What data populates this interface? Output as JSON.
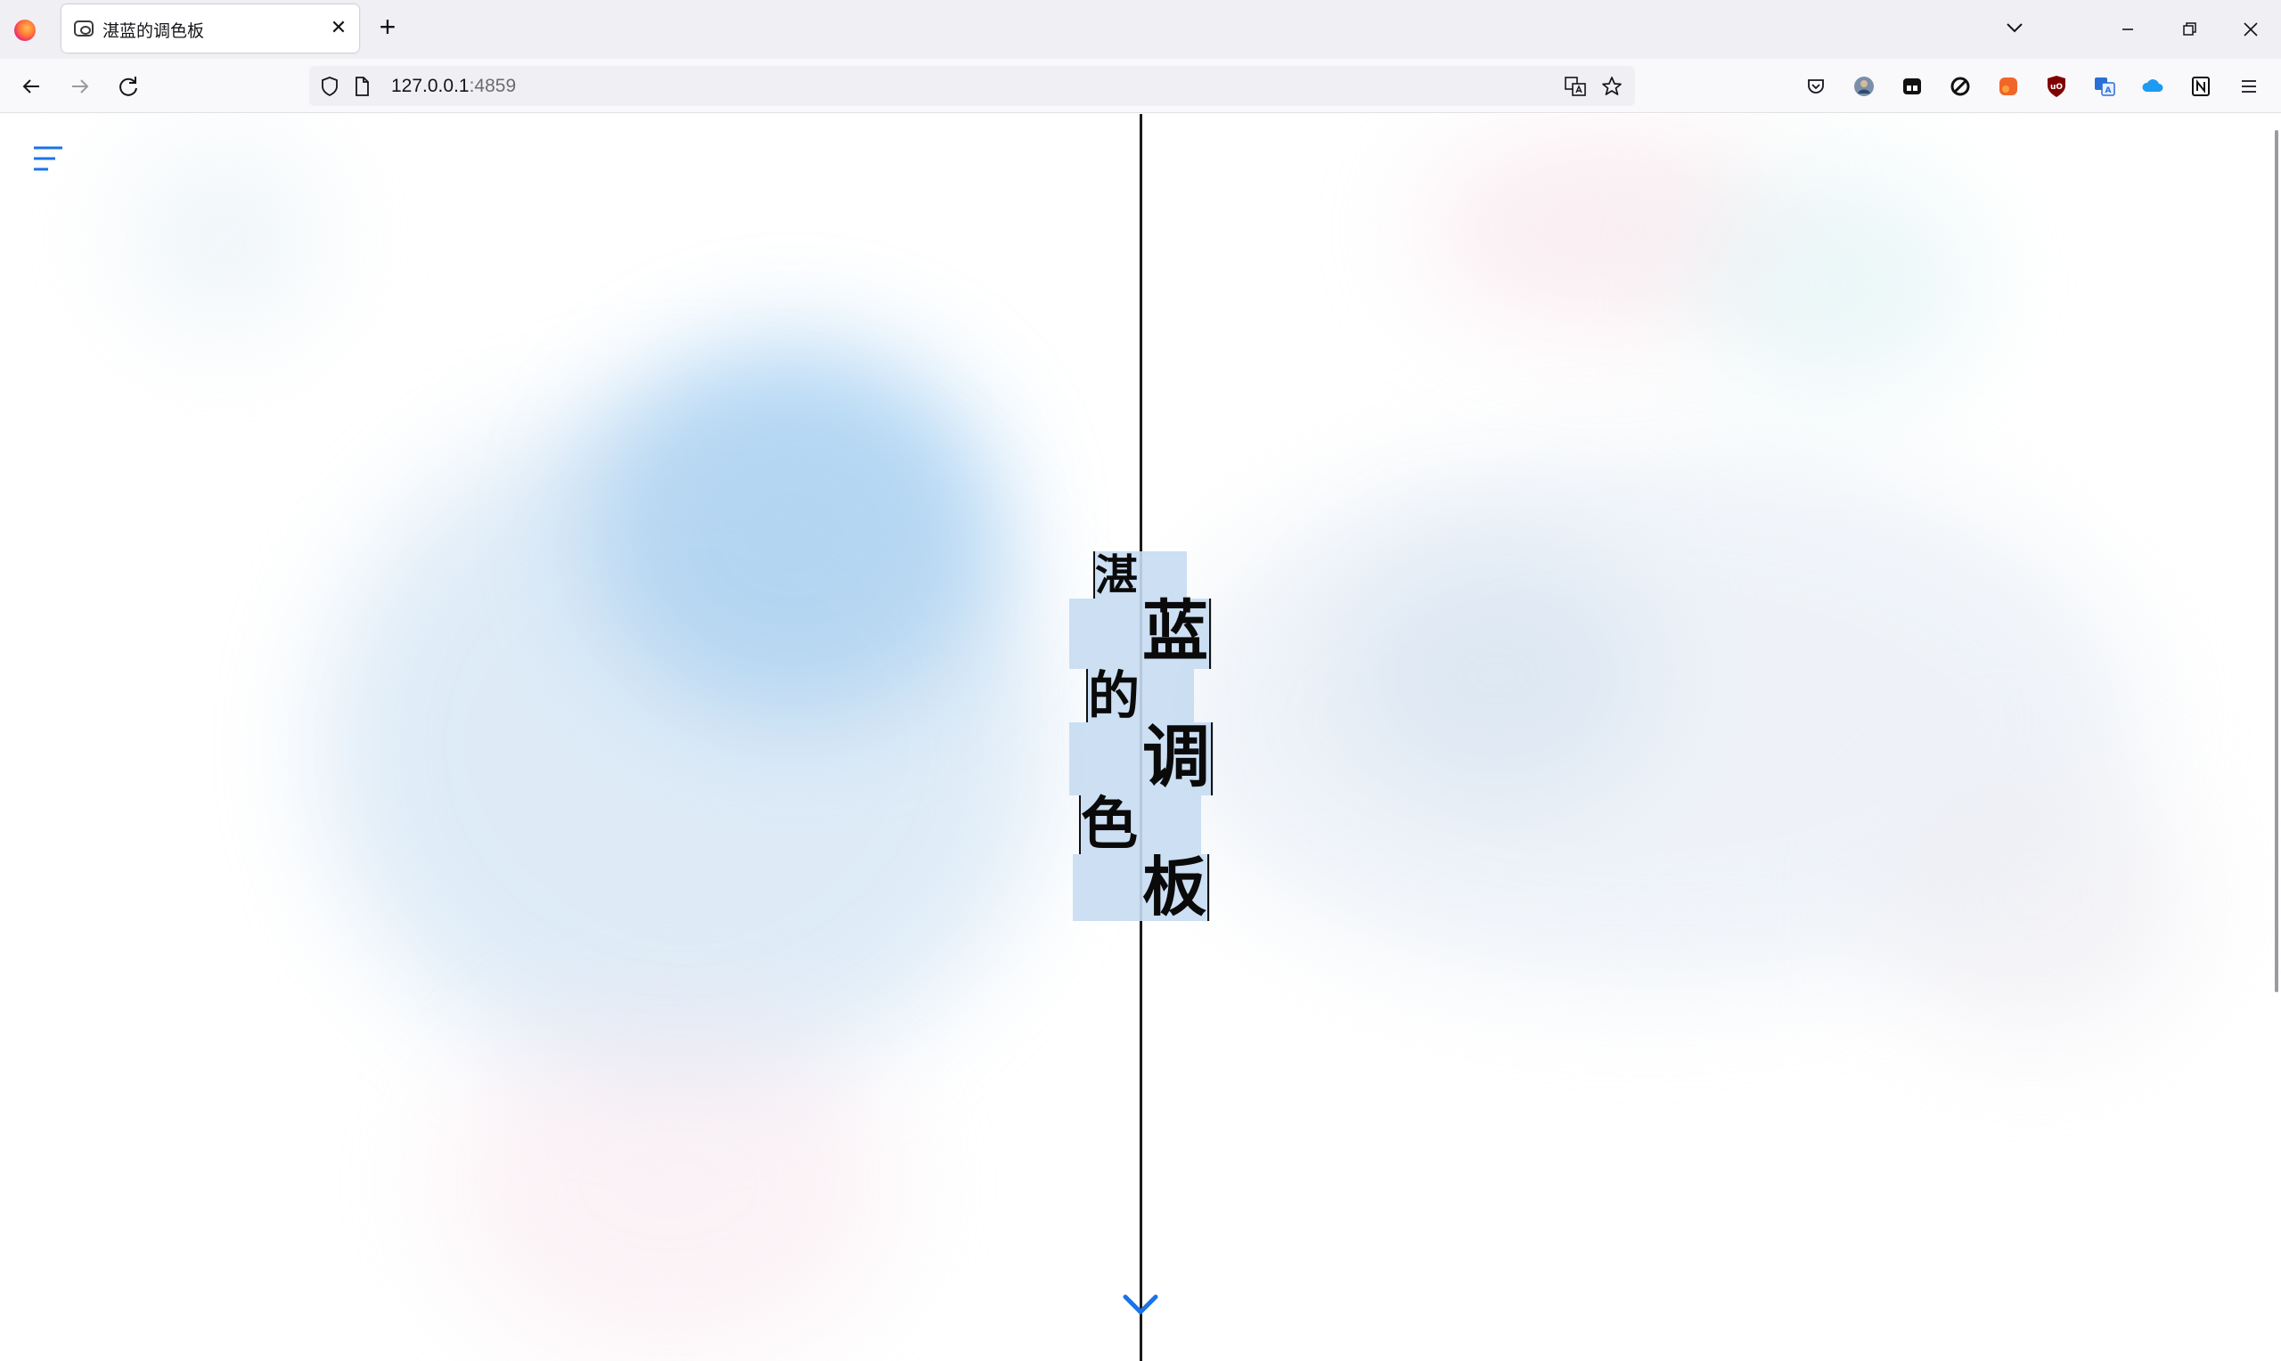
{
  "browser": {
    "tab": {
      "title": "湛蓝的调色板"
    },
    "url": {
      "host": "127.0.0.1",
      "port": ":4859"
    }
  },
  "page": {
    "title_chars": [
      "湛",
      "蓝",
      "的",
      "调",
      "色",
      "板"
    ],
    "accent_color": "#1a73e8",
    "highlight_color": "#c6dcf2"
  },
  "icons": {
    "menu": "menu-icon",
    "scroll_down": "chevron-down-icon"
  }
}
